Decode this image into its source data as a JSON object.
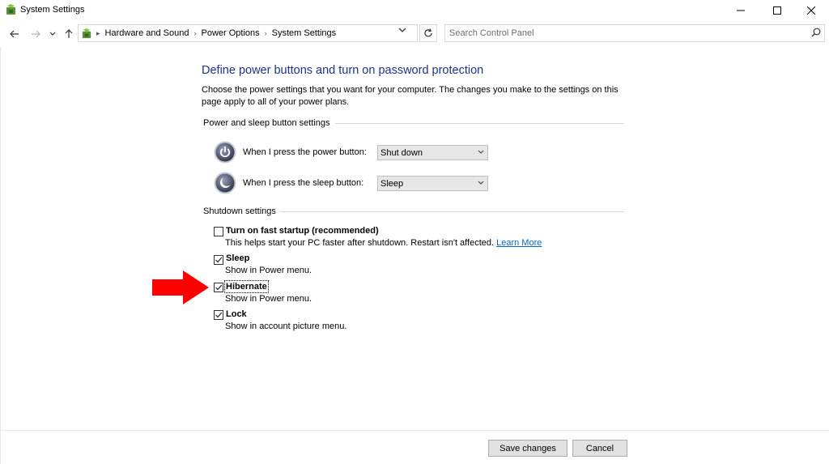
{
  "window": {
    "title": "System Settings"
  },
  "nav": {
    "breadcrumbs": [
      "Hardware and Sound",
      "Power Options",
      "System Settings"
    ],
    "search_placeholder": "Search Control Panel"
  },
  "page": {
    "heading": "Define power buttons and turn on password protection",
    "description": "Choose the power settings that you want for your computer. The changes you make to the settings on this page apply to all of your power plans."
  },
  "power_section": {
    "title": "Power and sleep button settings",
    "power_button": {
      "label": "When I press the power button:",
      "value": "Shut down"
    },
    "sleep_button": {
      "label": "When I press the sleep button:",
      "value": "Sleep"
    }
  },
  "shutdown_section": {
    "title": "Shutdown settings",
    "items": [
      {
        "label": "Turn on fast startup (recommended)",
        "desc": "This helps start your PC faster after shutdown. Restart isn't affected.",
        "link": "Learn More",
        "checked": false
      },
      {
        "label": "Sleep",
        "desc": "Show in Power menu.",
        "checked": true
      },
      {
        "label": "Hibernate",
        "desc": "Show in Power menu.",
        "checked": true
      },
      {
        "label": "Lock",
        "desc": "Show in account picture menu.",
        "checked": true
      }
    ]
  },
  "footer": {
    "save_label": "Save changes",
    "cancel_label": "Cancel"
  },
  "colors": {
    "heading": "#1e3287",
    "link": "#0066cc",
    "annotation_arrow": "#ff0000"
  },
  "icons": {
    "app": "control-panel-icon",
    "power": "power-icon",
    "sleep": "moon-icon",
    "search": "search-icon"
  }
}
